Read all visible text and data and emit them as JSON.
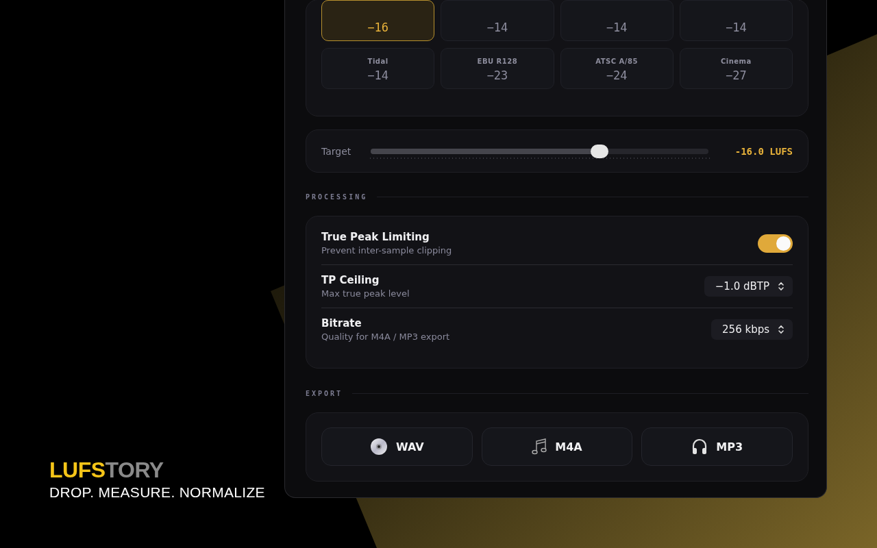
{
  "presets": [
    {
      "value": "−16",
      "selected": true
    },
    {
      "value": "−14",
      "selected": false
    },
    {
      "value": "−14",
      "selected": false
    },
    {
      "value": "−14",
      "selected": false
    },
    {
      "label": "Tidal",
      "value": "−14",
      "selected": false
    },
    {
      "label": "EBU R128",
      "value": "−23",
      "selected": false
    },
    {
      "label": "ATSC A/85",
      "value": "−24",
      "selected": false
    },
    {
      "label": "Cinema",
      "value": "−27",
      "selected": false
    }
  ],
  "target": {
    "label": "Target",
    "level": 0.677,
    "reading": "-16.0 LUFS"
  },
  "processing": {
    "heading": "PROCESSING",
    "rows": [
      {
        "kind": "toggle",
        "title": "True Peak Limiting",
        "subtitle": "Prevent inter-sample clipping",
        "on": true
      },
      {
        "kind": "select",
        "title": "TP Ceiling",
        "subtitle": "Max true peak level",
        "value": "−1.0 dBTP"
      },
      {
        "kind": "select",
        "title": "Bitrate",
        "subtitle": "Quality for M4A / MP3 export",
        "value": "256 kbps"
      }
    ]
  },
  "export": {
    "heading": "EXPORT",
    "buttons": [
      {
        "kind": "disc",
        "label": "WAV"
      },
      {
        "kind": "notes",
        "label": "M4A"
      },
      {
        "kind": "headphones",
        "label": "MP3"
      }
    ]
  },
  "brand": {
    "accent": "LUFS",
    "rest": "TORY",
    "tagline": "DROP. MEASURE. NORMALIZE"
  }
}
